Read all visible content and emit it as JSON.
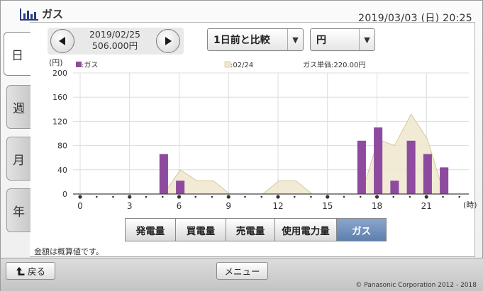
{
  "header": {
    "title": "ガス",
    "clock": "2019/03/03 (日) 20:25",
    "logo_icon": "bar-chart-icon"
  },
  "tabs": [
    {
      "label": "日",
      "active": true
    },
    {
      "label": "週",
      "active": false
    },
    {
      "label": "月",
      "active": false
    },
    {
      "label": "年",
      "active": false
    }
  ],
  "date_nav": {
    "date": "2019/02/25",
    "amount": "506.000円",
    "prev_icon": "left-arrow-icon",
    "next_icon": "right-arrow-icon"
  },
  "selects": {
    "compare": "1日前と比較",
    "unit": "円"
  },
  "chart_data": {
    "type": "bar",
    "ylabel": "(円)",
    "xlabel": "(時)",
    "ylim": [
      0,
      200
    ],
    "yticks": [
      0,
      40,
      80,
      120,
      160,
      200
    ],
    "xticks": [
      "0",
      "3",
      "6",
      "9",
      "12",
      "15",
      "18",
      "21"
    ],
    "legend": {
      "current": "■:ガス",
      "previous": ":02/24",
      "unit_price": "ガス単価:220.00円"
    },
    "colors": {
      "current": "#8e4a9e",
      "previous": "#eee7cf",
      "previous_line": "#d9c79a"
    },
    "series": [
      {
        "name": "ガス",
        "values": [
          0,
          0,
          0,
          0,
          0,
          66,
          22,
          0,
          0,
          0,
          0,
          0,
          0,
          0,
          0,
          0,
          0,
          88,
          110,
          22,
          88,
          66,
          44,
          0
        ]
      },
      {
        "name": "02/24",
        "values": [
          0,
          0,
          0,
          0,
          0,
          0,
          40,
          22,
          22,
          0,
          0,
          0,
          22,
          22,
          0,
          0,
          0,
          0,
          90,
          80,
          132,
          90,
          0,
          0
        ]
      }
    ]
  },
  "categories": [
    {
      "label": "発電量",
      "active": false
    },
    {
      "label": "買電量",
      "active": false
    },
    {
      "label": "売電量",
      "active": false
    },
    {
      "label": "使用電力量",
      "active": false
    },
    {
      "label": "ガス",
      "active": true
    }
  ],
  "note": "金額は概算値です。",
  "footer": {
    "back": "戻る",
    "menu": "メニュー",
    "copyright": "© Panasonic Corporation 2012 - 2018",
    "back_icon": "return-arrow-icon"
  }
}
